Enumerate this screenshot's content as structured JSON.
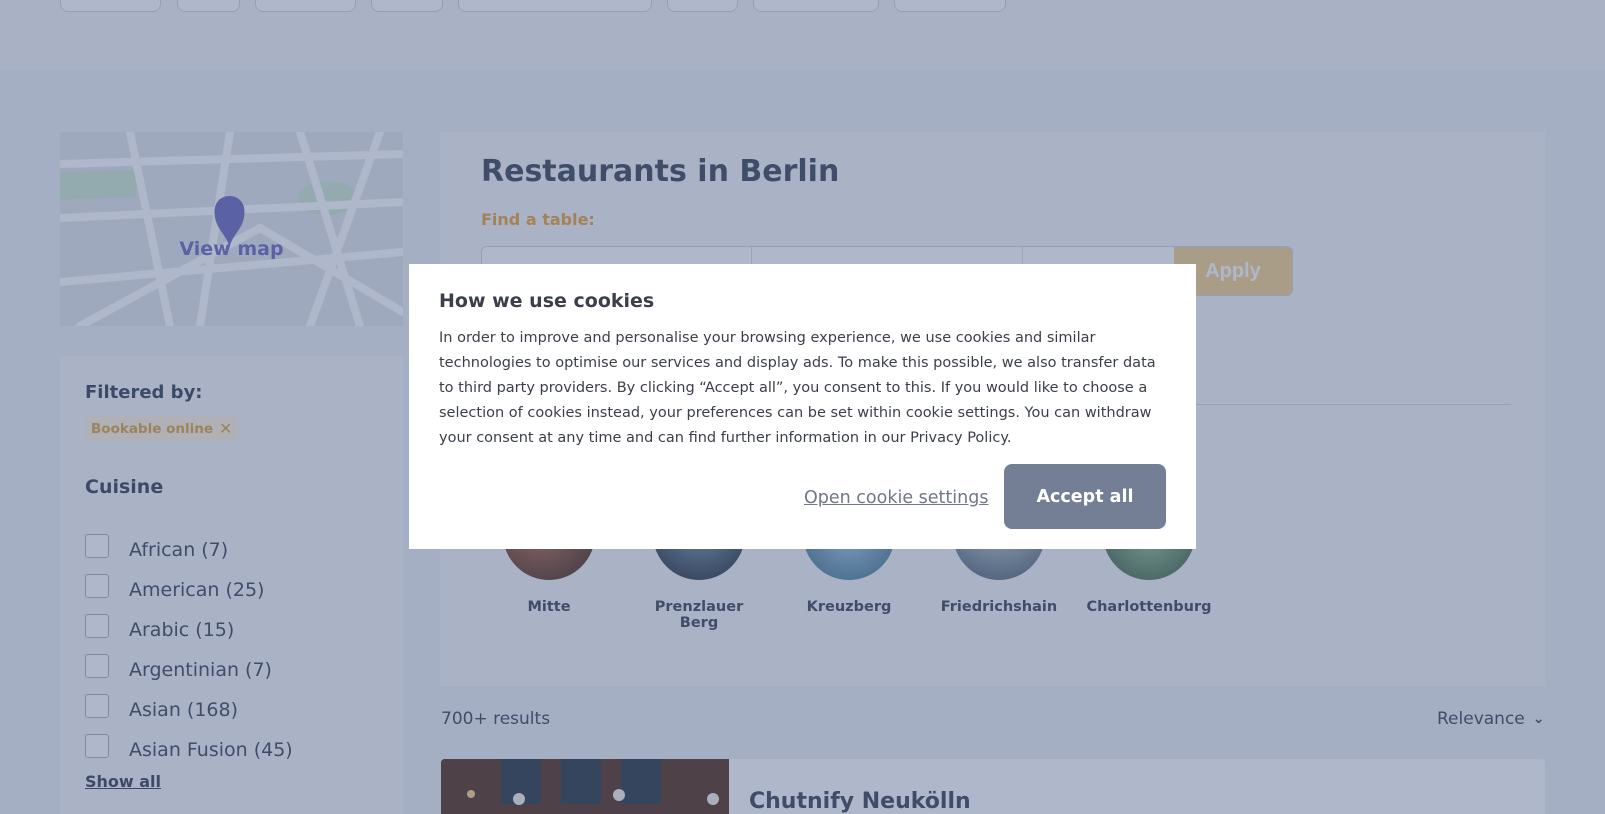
{
  "colors": {
    "accent_orange": "#e8a33a",
    "map_purple": "#6d6abf",
    "accept_button": "#747f96",
    "overlay": "#405680"
  },
  "map": {
    "label": "View map",
    "pin_icon": "location-pin-icon"
  },
  "filters": {
    "heading": "Filtered by:",
    "chip_label": "Bookable online",
    "chip_remove_icon": "close-icon"
  },
  "cuisine": {
    "heading": "Cuisine",
    "items": [
      {
        "label": "African (7)"
      },
      {
        "label": "American (25)"
      },
      {
        "label": "Arabic (15)"
      },
      {
        "label": "Argentinian (7)"
      },
      {
        "label": "Asian (168)"
      },
      {
        "label": "Asian Fusion (45)"
      }
    ],
    "show_all": "Show all"
  },
  "main": {
    "title": "Restaurants in Berlin",
    "find_table": "Find a table:",
    "apply_label": "Apply"
  },
  "neighborhoods": [
    {
      "label": "Mitte"
    },
    {
      "label": "Prenzlauer Berg"
    },
    {
      "label": "Kreuzberg"
    },
    {
      "label": "Friedrichshain"
    },
    {
      "label": "Charlottenburg"
    }
  ],
  "results": {
    "count": "700+ results",
    "sort_label": "Relevance",
    "sort_icon": "chevron-down-icon",
    "first_name": "Chutnify Neukölln"
  },
  "cookie_dialog": {
    "title": "How we use cookies",
    "body": "In order to improve and personalise your browsing experience, we use cookies and similar technologies to optimise our services and display ads. To make this possible, we also transfer data to third party providers. By clicking “Accept all”, you consent to this. If you would like to choose a selection of cookies instead, your preferences can be set within cookie settings. You can withdraw your consent at any time and can find further information in our Privacy Policy.",
    "settings_link": "Open cookie settings",
    "accept_label": "Accept all"
  }
}
